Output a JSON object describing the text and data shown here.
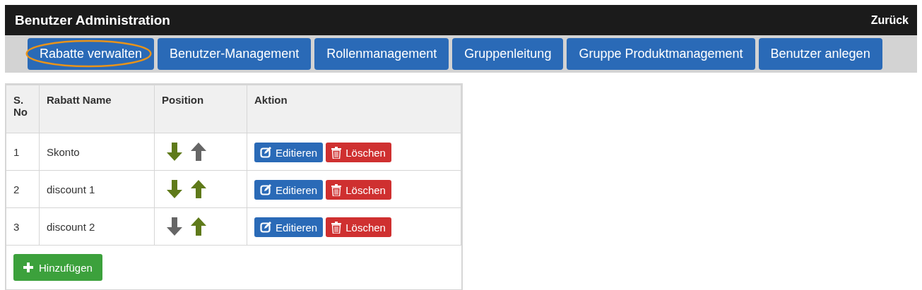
{
  "header": {
    "title": "Benutzer Administration",
    "back_link": "Zurück"
  },
  "tabs": [
    {
      "label": "Rabatte verwalten",
      "selected": true
    },
    {
      "label": "Benutzer-Management",
      "selected": false
    },
    {
      "label": "Rollenmanagement",
      "selected": false
    },
    {
      "label": "Gruppenleitung",
      "selected": false
    },
    {
      "label": "Gruppe Produktmanagement",
      "selected": false
    },
    {
      "label": "Benutzer anlegen",
      "selected": false
    }
  ],
  "table": {
    "columns": [
      "S. No",
      "Rabatt Name",
      "Position",
      "Aktion"
    ],
    "rows": [
      {
        "no": "1",
        "name": "Skonto",
        "down_enabled": true,
        "up_enabled": false,
        "edit": "Editieren",
        "delete": "Löschen"
      },
      {
        "no": "2",
        "name": "discount 1",
        "down_enabled": true,
        "up_enabled": true,
        "edit": "Editieren",
        "delete": "Löschen"
      },
      {
        "no": "3",
        "name": "discount 2",
        "down_enabled": false,
        "up_enabled": true,
        "edit": "Editieren",
        "delete": "Löschen"
      }
    ],
    "add_button": "Hinzufügen"
  }
}
